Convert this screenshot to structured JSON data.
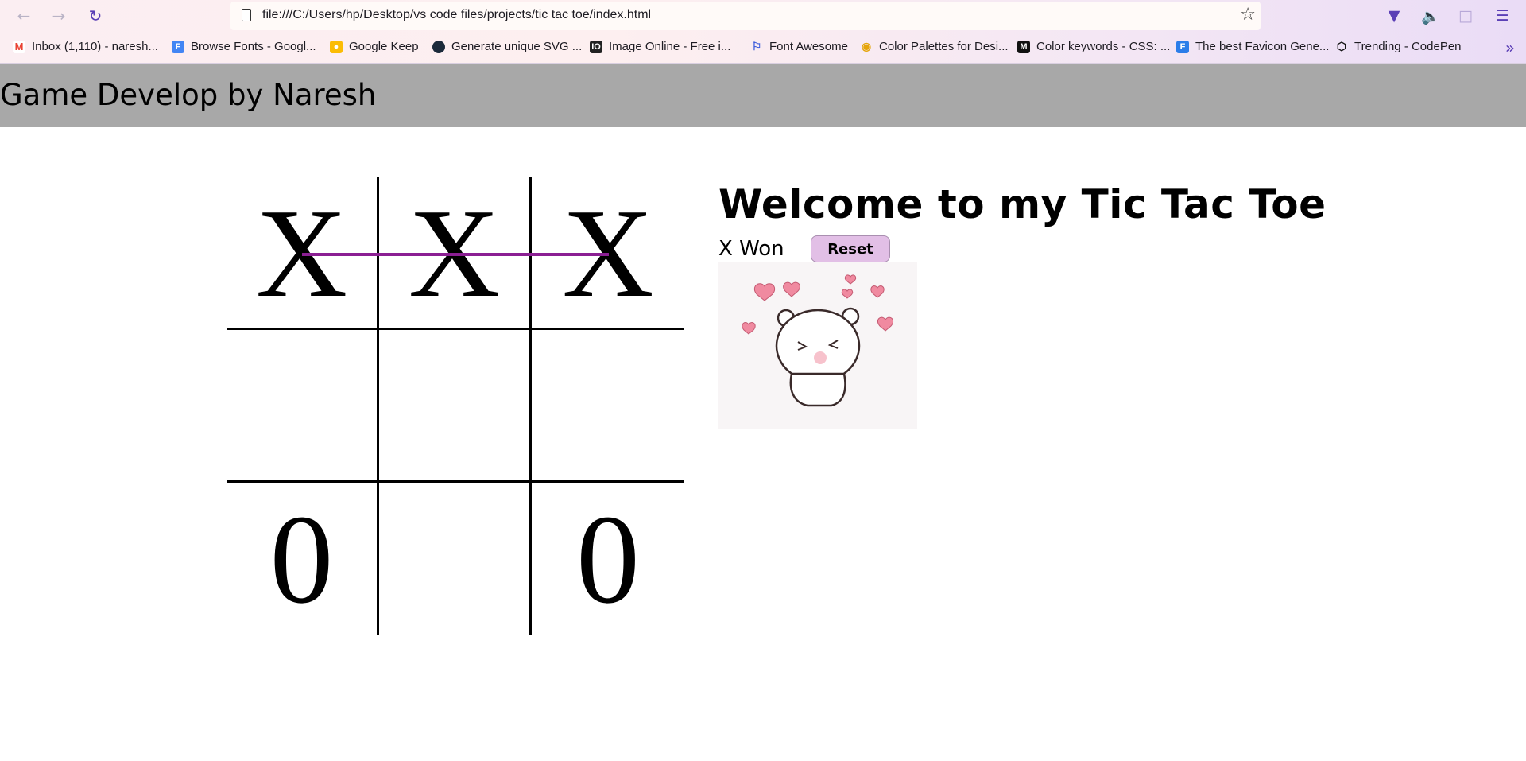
{
  "browser": {
    "url": "file:///C:/Users/hp/Desktop/vs code files/projects/tic tac toe/index.html",
    "bookmarks": [
      {
        "label": "Inbox (1,110) - naresh...",
        "icon": "gmail-icon",
        "color": "#ea4335"
      },
      {
        "label": "Browse Fonts - Googl...",
        "icon": "google-fonts-icon",
        "color": "#4285f4"
      },
      {
        "label": "Google Keep",
        "icon": "keep-icon",
        "color": "#fbbc04"
      },
      {
        "label": "Generate unique SVG ...",
        "icon": "svg-generator-icon",
        "color": "#1b2a3a"
      },
      {
        "label": "Image Online - Free i...",
        "icon": "io-icon",
        "color": "#222222"
      },
      {
        "label": "Font Awesome",
        "icon": "flag-icon",
        "color": "#3b5bdb"
      },
      {
        "label": "Color Palettes for Desi...",
        "icon": "palette-icon",
        "color": "#e5a50a"
      },
      {
        "label": "Color keywords - CSS: ...",
        "icon": "mdn-icon",
        "color": "#111111"
      },
      {
        "label": "The best Favicon Gene...",
        "icon": "favicon-icon",
        "color": "#2b7de9"
      },
      {
        "label": "Trending - CodePen",
        "icon": "codepen-icon",
        "color": "#111111"
      }
    ]
  },
  "page": {
    "header_title": "Game Develop by Naresh",
    "welcome": "Welcome to my Tic Tac Toe",
    "status": "X Won",
    "reset_label": "Reset"
  },
  "board": {
    "cells": [
      "X",
      "X",
      "X",
      "",
      "",
      "",
      "0",
      "",
      "0"
    ],
    "winning_line_color": "#8b1f93"
  }
}
